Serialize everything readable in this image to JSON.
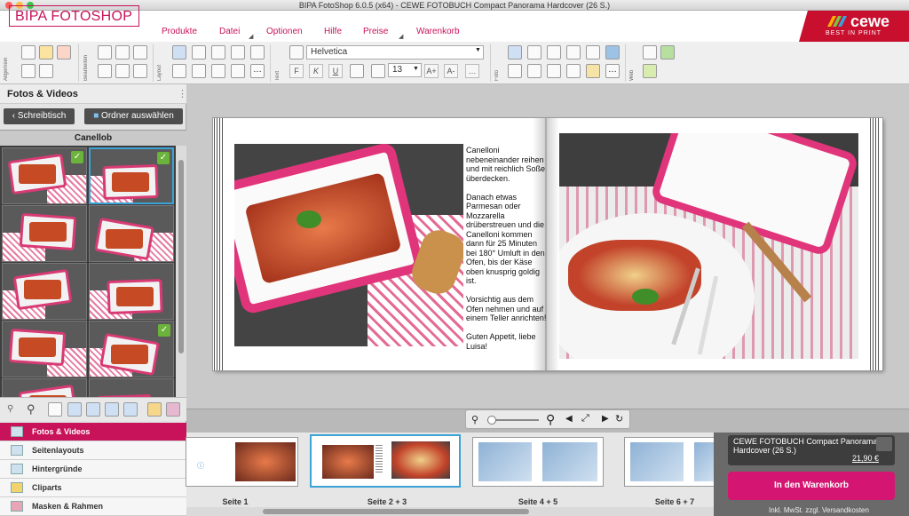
{
  "window": {
    "title": "BIPA FotoShop 6.0.5 (x64) - CEWE FOTOBUCH Compact Panorama Hardcover  (26 S.)"
  },
  "brand": {
    "logo": "BIPA FOTOSHOP",
    "partner": "cewe",
    "partner_tagline": "BEST IN PRINT"
  },
  "menu": [
    "Produkte",
    "Datei",
    "Optionen",
    "Hilfe",
    "Preise",
    "Warenkorb"
  ],
  "toolbar": {
    "groups": [
      "Allgemein",
      "Bearbeiten",
      "Layout",
      "Text",
      "Foto",
      "Web"
    ],
    "font": "Helvetica",
    "font_size": "13",
    "text_buttons": [
      "F",
      "K",
      "U"
    ]
  },
  "left_panel": {
    "title": "Fotos & Videos",
    "back_button": "Schreibtisch",
    "folder_button": "Ordner auswählen",
    "folder_name": "Canellob",
    "checked_thumbs": [
      0,
      1,
      7
    ]
  },
  "nav": [
    "Fotos & Videos",
    "Seitenlayouts",
    "Hintergründe",
    "Cliparts",
    "Masken & Rahmen"
  ],
  "page_text": "Canelloni nebeneinander reihen und mit reichlich Soße überdecken.\n\nDanach etwas Parmesan oder Mozzarella drüberstreuen und die Canelloni kommen dann für 25 Minuten bei 180° Umluft in den Ofen, bis der Käse oben knusprig goldig ist.\n\nVorsichtig aus dem Ofen nehmen und auf einem Teller anrichten!\n\nGuten Appetit, liebe Luisa!",
  "filmstrip": {
    "labels": [
      "Seite 1",
      "Seite 2 + 3",
      "Seite 4 + 5",
      "Seite 6 + 7"
    ]
  },
  "order": {
    "product": "CEWE FOTOBUCH Compact Panorama Hardcover  (26 S.)",
    "price": "21,90 €",
    "cart_button": "In den Warenkorb",
    "note": "Inkl. MwSt. zzgl. Versandkosten"
  },
  "colors": {
    "accent": "#c8125a",
    "cewe_red": "#c8102e",
    "selection": "#3ba3d6",
    "check": "#6bb33a"
  }
}
